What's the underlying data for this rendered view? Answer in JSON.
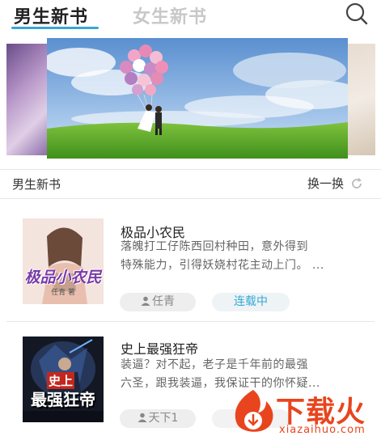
{
  "tabs": {
    "male_label": "男生新书",
    "female_label": "女生新书"
  },
  "section": {
    "title": "男生新书",
    "refresh_label": "换一换"
  },
  "books": [
    {
      "title": "极品小农民",
      "desc_line1": "落魄打工仔陈西回村种田，意外得到",
      "desc_line2": "特殊能力，引得妖娆村花主动上门。 ...",
      "author": "任青",
      "status": "连载中",
      "cover_text": "极品小农民",
      "cover_sub": "任青 著"
    },
    {
      "title": "史上最强狂帝",
      "desc_line1": "装逼？对不起，老子是千年前的最强",
      "desc_line2": "六圣，跟我装逼，我保证干的你怀疑...",
      "author": "天下1",
      "cover_text_top": "史上",
      "cover_text": "最强狂帝"
    }
  ],
  "watermark": {
    "brand": "下载火",
    "url": "xiazaihuo.com"
  },
  "colors": {
    "accent": "#35a8d6",
    "watermark": "#e8451e"
  },
  "icons": {
    "search": "search-icon",
    "refresh": "refresh-icon",
    "author": "person-icon"
  }
}
